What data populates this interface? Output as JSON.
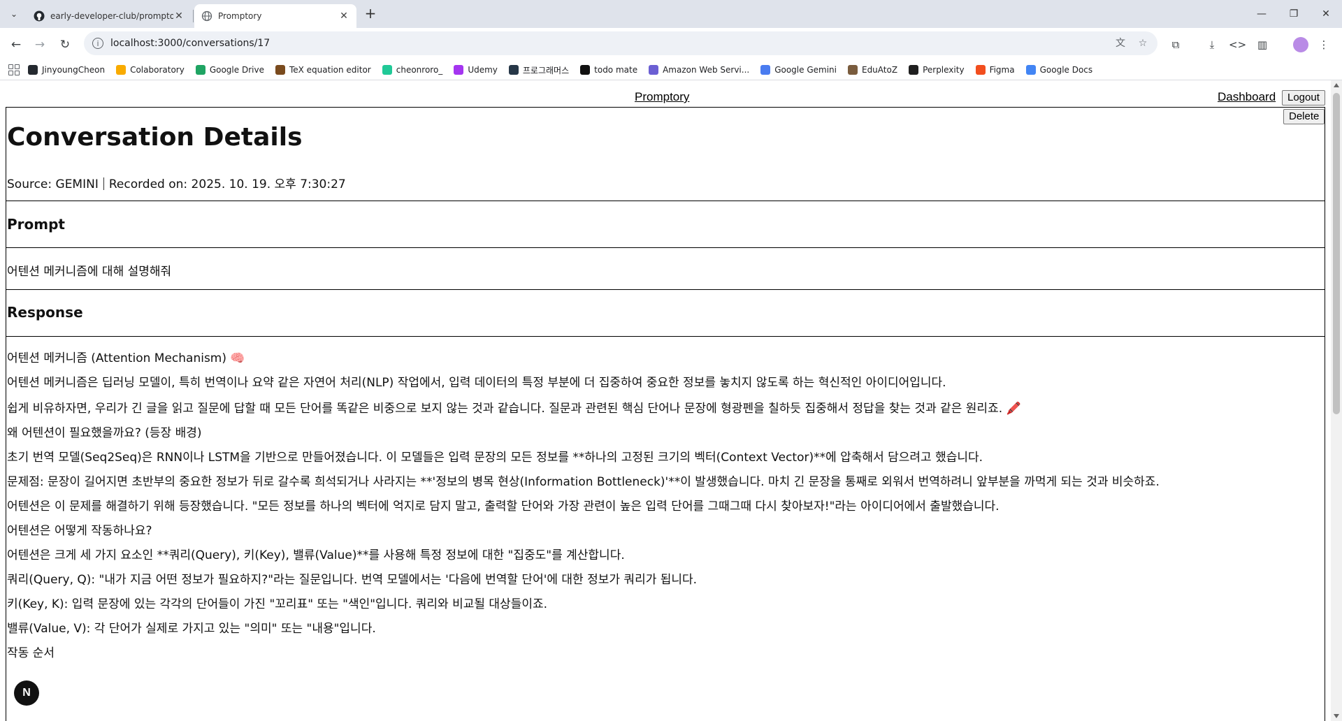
{
  "browser": {
    "tabs": [
      {
        "title": "early-developer-club/promptory",
        "active": false
      },
      {
        "title": "Promptory",
        "active": true
      }
    ],
    "url": "localhost:3000/conversations/17",
    "bookmarks": [
      {
        "label": "JinyoungCheon",
        "icon": "github-icon",
        "color": "#24292f"
      },
      {
        "label": "Colaboratory",
        "icon": "colab-icon",
        "color": "#f9ab00"
      },
      {
        "label": "Google Drive",
        "icon": "drive-icon",
        "color": "#1fa463"
      },
      {
        "label": "TeX equation editor",
        "icon": "tex-icon",
        "color": "#7a4b1e"
      },
      {
        "label": "cheonroro_",
        "icon": "velog-icon",
        "color": "#20c997"
      },
      {
        "label": "Udemy",
        "icon": "udemy-icon",
        "color": "#a435f0"
      },
      {
        "label": "프로그래머스",
        "icon": "programmers-icon",
        "color": "#263747"
      },
      {
        "label": "todo mate",
        "icon": "todomate-icon",
        "color": "#111111"
      },
      {
        "label": "Amazon Web Servi...",
        "icon": "aws-icon",
        "color": "#6b5fd3"
      },
      {
        "label": "Google Gemini",
        "icon": "gemini-icon",
        "color": "#4a7cf0"
      },
      {
        "label": "EduAtoZ",
        "icon": "eduatoz-icon",
        "color": "#7a5c3e"
      },
      {
        "label": "Perplexity",
        "icon": "perplexity-icon",
        "color": "#1f1f1f"
      },
      {
        "label": "Figma",
        "icon": "figma-icon",
        "color": "#f24e1e"
      },
      {
        "label": "Google Docs",
        "icon": "docs-icon",
        "color": "#4285f4"
      }
    ]
  },
  "nav": {
    "brand": "Promptory",
    "dashboard": "Dashboard",
    "logout": "Logout",
    "delete": "Delete"
  },
  "details": {
    "title": "Conversation Details",
    "source": "Source: GEMINI",
    "recorded": "Recorded on: 2025. 10. 19. 오후 7:30:27"
  },
  "prompt": {
    "heading": "Prompt",
    "text": "어텐션 메커니즘에 대해 설명해줘"
  },
  "response": {
    "heading": "Response",
    "lines": [
      "어텐션 메커니즘 (Attention Mechanism) 🧠",
      "어텐션 메커니즘은 딥러닝 모델이, 특히 번역이나 요약 같은 자연어 처리(NLP) 작업에서, 입력 데이터의 특정 부분에 더 집중하여 중요한 정보를 놓치지 않도록 하는 혁신적인 아이디어입니다.",
      "쉽게 비유하자면, 우리가 긴 글을 읽고 질문에 답할 때 모든 단어를 똑같은 비중으로 보지 않는 것과 같습니다. 질문과 관련된 핵심 단어나 문장에 형광펜을 칠하듯 집중해서 정답을 찾는 것과 같은 원리죠. 🖍️",
      "왜 어텐션이 필요했을까요? (등장 배경)",
      "초기 번역 모델(Seq2Seq)은 RNN이나 LSTM을 기반으로 만들어졌습니다. 이 모델들은 입력 문장의 모든 정보를 **하나의 고정된 크기의 벡터(Context Vector)**에 압축해서 담으려고 했습니다.",
      "문제점: 문장이 길어지면 초반부의 중요한 정보가 뒤로 갈수록 희석되거나 사라지는 **'정보의 병목 현상(Information Bottleneck)'**이 발생했습니다. 마치 긴 문장을 통째로 외워서 번역하려니 앞부분을 까먹게 되는 것과 비슷하죠.",
      "어텐션은 이 문제를 해결하기 위해 등장했습니다. \"모든 정보를 하나의 벡터에 억지로 담지 말고, 출력할 단어와 가장 관련이 높은 입력 단어를 그때그때 다시 찾아보자!\"라는 아이디어에서 출발했습니다.",
      "어텐션은 어떻게 작동하나요?",
      "어텐션은 크게 세 가지 요소인 **쿼리(Query), 키(Key), 밸류(Value)**를 사용해 특정 정보에 대한 \"집중도\"를 계산합니다.",
      "쿼리(Query, Q): \"내가 지금 어떤 정보가 필요하지?\"라는 질문입니다. 번역 모델에서는 '다음에 번역할 단어'에 대한 정보가 쿼리가 됩니다.",
      "키(Key, K): 입력 문장에 있는 각각의 단어들이 가진 \"꼬리표\" 또는 \"색인\"입니다. 쿼리와 비교될 대상들이죠.",
      "밸류(Value, V): 각 단어가 실제로 가지고 있는 \"의미\" 또는 \"내용\"입니다.",
      "작동 순서"
    ]
  },
  "overlay": {
    "badge": "N"
  }
}
